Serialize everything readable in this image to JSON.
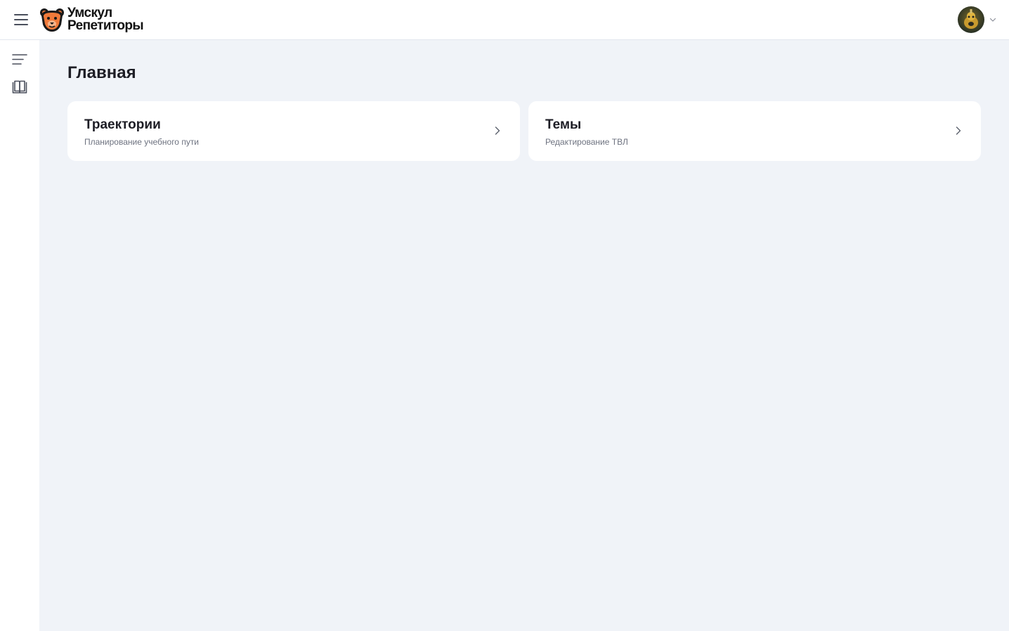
{
  "header": {
    "logo_line1": "Умскул",
    "logo_line2": "Репетиторы",
    "menu_icon": "hamburger-icon",
    "user_menu_icon": "chevron-down-icon"
  },
  "sidebar": {
    "items": [
      {
        "icon": "list-icon"
      },
      {
        "icon": "book-icon"
      }
    ]
  },
  "main": {
    "title": "Главная",
    "cards": [
      {
        "title": "Траектории",
        "subtitle": "Планирование учебного пути",
        "icon": "chevron-right-icon"
      },
      {
        "title": "Темы",
        "subtitle": "Редактирование ТВЛ",
        "icon": "chevron-right-icon"
      }
    ]
  },
  "colors": {
    "background": "#f0f3f8",
    "card": "#ffffff",
    "brand_orange": "#f07a3a",
    "text": "#1d1d25",
    "muted_text": "#6e7380"
  }
}
